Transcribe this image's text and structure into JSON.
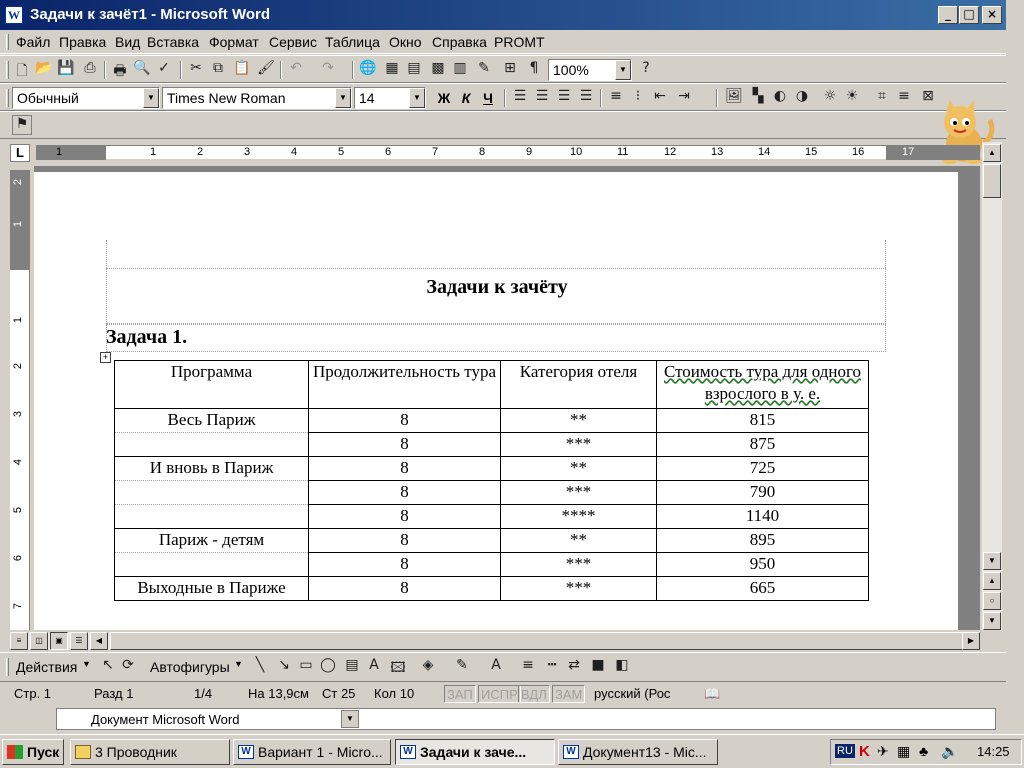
{
  "window": {
    "title": "Задачи к зачёт1 - Microsoft Word",
    "app_icon": "word-icon",
    "controls": [
      "_",
      "□",
      "×"
    ]
  },
  "menu": [
    "Файл",
    "Правка",
    "Вид",
    "Вставка",
    "Формат",
    "Сервис",
    "Таблица",
    "Окно",
    "Справка",
    "PROMT"
  ],
  "standard_toolbar": {
    "zoom": "100%"
  },
  "format_toolbar": {
    "style": "Обычный",
    "font": "Times New Roman",
    "size": "14",
    "bold": "Ж",
    "italic": "К",
    "underline": "Ч"
  },
  "ruler": {
    "corner": "L",
    "numbers": [
      "1",
      "1",
      "2",
      "3",
      "4",
      "5",
      "6",
      "7",
      "8",
      "9",
      "10",
      "11",
      "12",
      "13",
      "14",
      "15",
      "16",
      "17"
    ],
    "vnumbers": [
      "2",
      "1",
      "1",
      "2",
      "3",
      "4",
      "5",
      "6",
      "7"
    ]
  },
  "document": {
    "title": "Задачи к зачёту",
    "task": "Задача 1.",
    "table": {
      "headers": [
        "Программа",
        "Продолжительность тура",
        "Категория отеля",
        "Стоимость тура для одного взрослого в у. е."
      ],
      "rows": [
        {
          "program": "Весь Париж",
          "duration": "8",
          "category": "**",
          "price": "815"
        },
        {
          "program": "",
          "duration": "8",
          "category": "***",
          "price": "875"
        },
        {
          "program": "И вновь в Париж",
          "duration": "8",
          "category": "**",
          "price": "725"
        },
        {
          "program": "",
          "duration": "8",
          "category": "***",
          "price": "790"
        },
        {
          "program": "",
          "duration": "8",
          "category": "****",
          "price": "1140"
        },
        {
          "program": "Париж - детям",
          "duration": "8",
          "category": "**",
          "price": "895"
        },
        {
          "program": "",
          "duration": "8",
          "category": "***",
          "price": "950"
        },
        {
          "program": "Выходные в Париже",
          "duration": "8",
          "category": "***",
          "price": "665"
        }
      ]
    }
  },
  "drawing_toolbar": {
    "actions": "Действия",
    "autoshapes": "Автофигуры"
  },
  "status": {
    "page": "Стр.  1",
    "section": "Разд  1",
    "pages": "1/4",
    "at": "На 13,9см",
    "line": "Ст  25",
    "col": "Кол  10",
    "rec": "ЗАП",
    "trk": "ИСПР",
    "ext": "ВДЛ",
    "ovr": "ЗАМ",
    "lang": "русский (Рос"
  },
  "input_field": {
    "value": "Документ Microsoft Word"
  },
  "taskbar": {
    "start": "Пуск",
    "tasks": [
      "3 Проводник",
      "Вариант 1 - Micro...",
      "Задачи к заче...",
      "Документ13 - Mic..."
    ],
    "lang": "RU",
    "time": "14:25"
  }
}
